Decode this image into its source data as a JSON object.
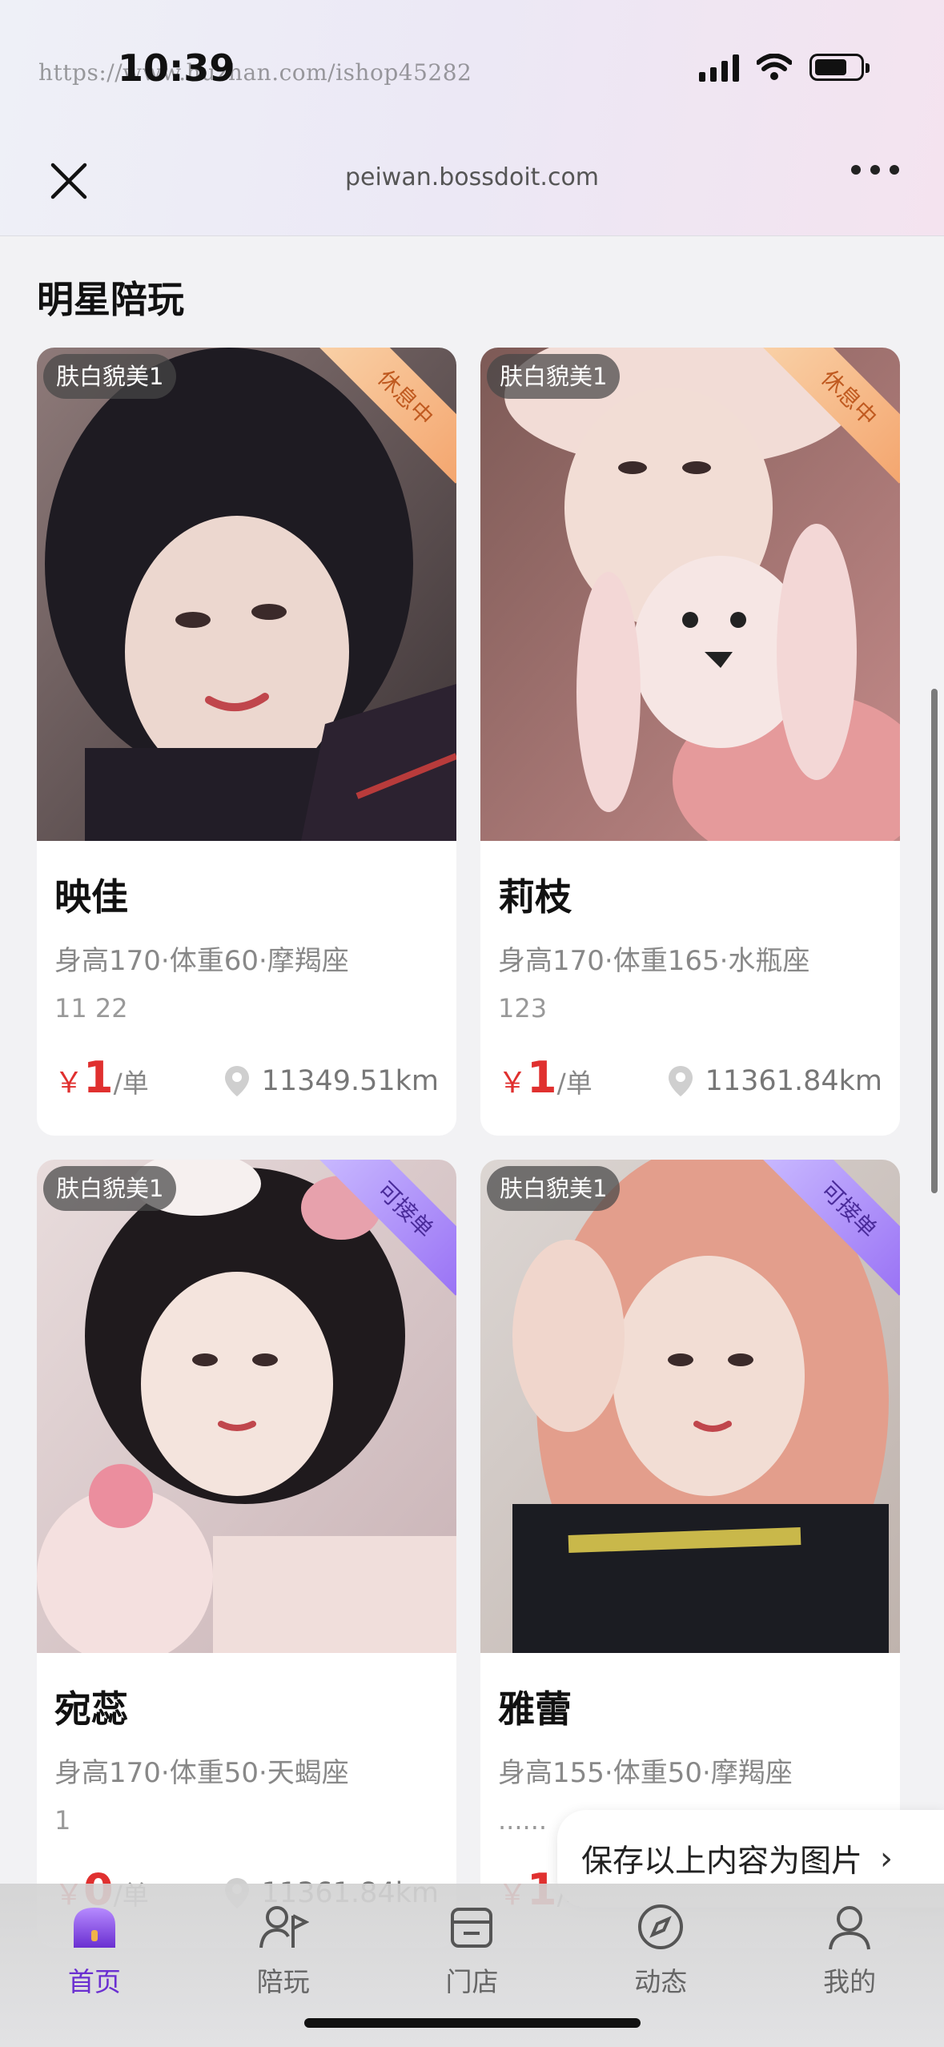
{
  "status": {
    "time": "10:39",
    "watermark": "https://www.huzhan.com/ishop45282"
  },
  "browser": {
    "url": "peiwan.bossdoit.com"
  },
  "section": {
    "title": "明星陪玩"
  },
  "cards": [
    {
      "tag": "肤白貌美1",
      "badge": "休息中",
      "name": "映佳",
      "attrs": "身高170·体重60·摩羯座",
      "desc": "11 22",
      "price_symbol": "￥",
      "price": "1",
      "unit": "/单",
      "distance": "11349.51km"
    },
    {
      "tag": "肤白貌美1",
      "badge": "休息中",
      "name": "莉枝",
      "attrs": "身高170·体重165·水瓶座",
      "desc": "123",
      "price_symbol": "￥",
      "price": "1",
      "unit": "/单",
      "distance": "11361.84km"
    },
    {
      "tag": "肤白貌美1",
      "badge": "可接单",
      "name": "宛蕊",
      "attrs": "身高170·体重50·天蝎座",
      "desc": "1",
      "price_symbol": "￥",
      "price": "0",
      "unit": "/单",
      "distance": "11361.84km"
    },
    {
      "tag": "肤白貌美1",
      "badge": "可接单",
      "name": "雅蕾",
      "attrs": "身高155·体重50·摩羯座",
      "desc": "......",
      "price_symbol": "￥",
      "price": "1",
      "unit": "/单",
      "distance": ""
    }
  ],
  "save_button": {
    "label": "保存以上内容为图片",
    "chevron": "›"
  },
  "tabbar": [
    {
      "label": "首页",
      "icon": "home-icon",
      "active": true
    },
    {
      "label": "陪玩",
      "icon": "player-icon",
      "active": false
    },
    {
      "label": "门店",
      "icon": "store-icon",
      "active": false
    },
    {
      "label": "动态",
      "icon": "compass-icon",
      "active": false
    },
    {
      "label": "我的",
      "icon": "profile-icon",
      "active": false
    }
  ],
  "colors": {
    "accent": "#6a2fd1",
    "price": "#e0302f",
    "badge_rest": "#f4a66f",
    "badge_open": "#9a73f5"
  }
}
